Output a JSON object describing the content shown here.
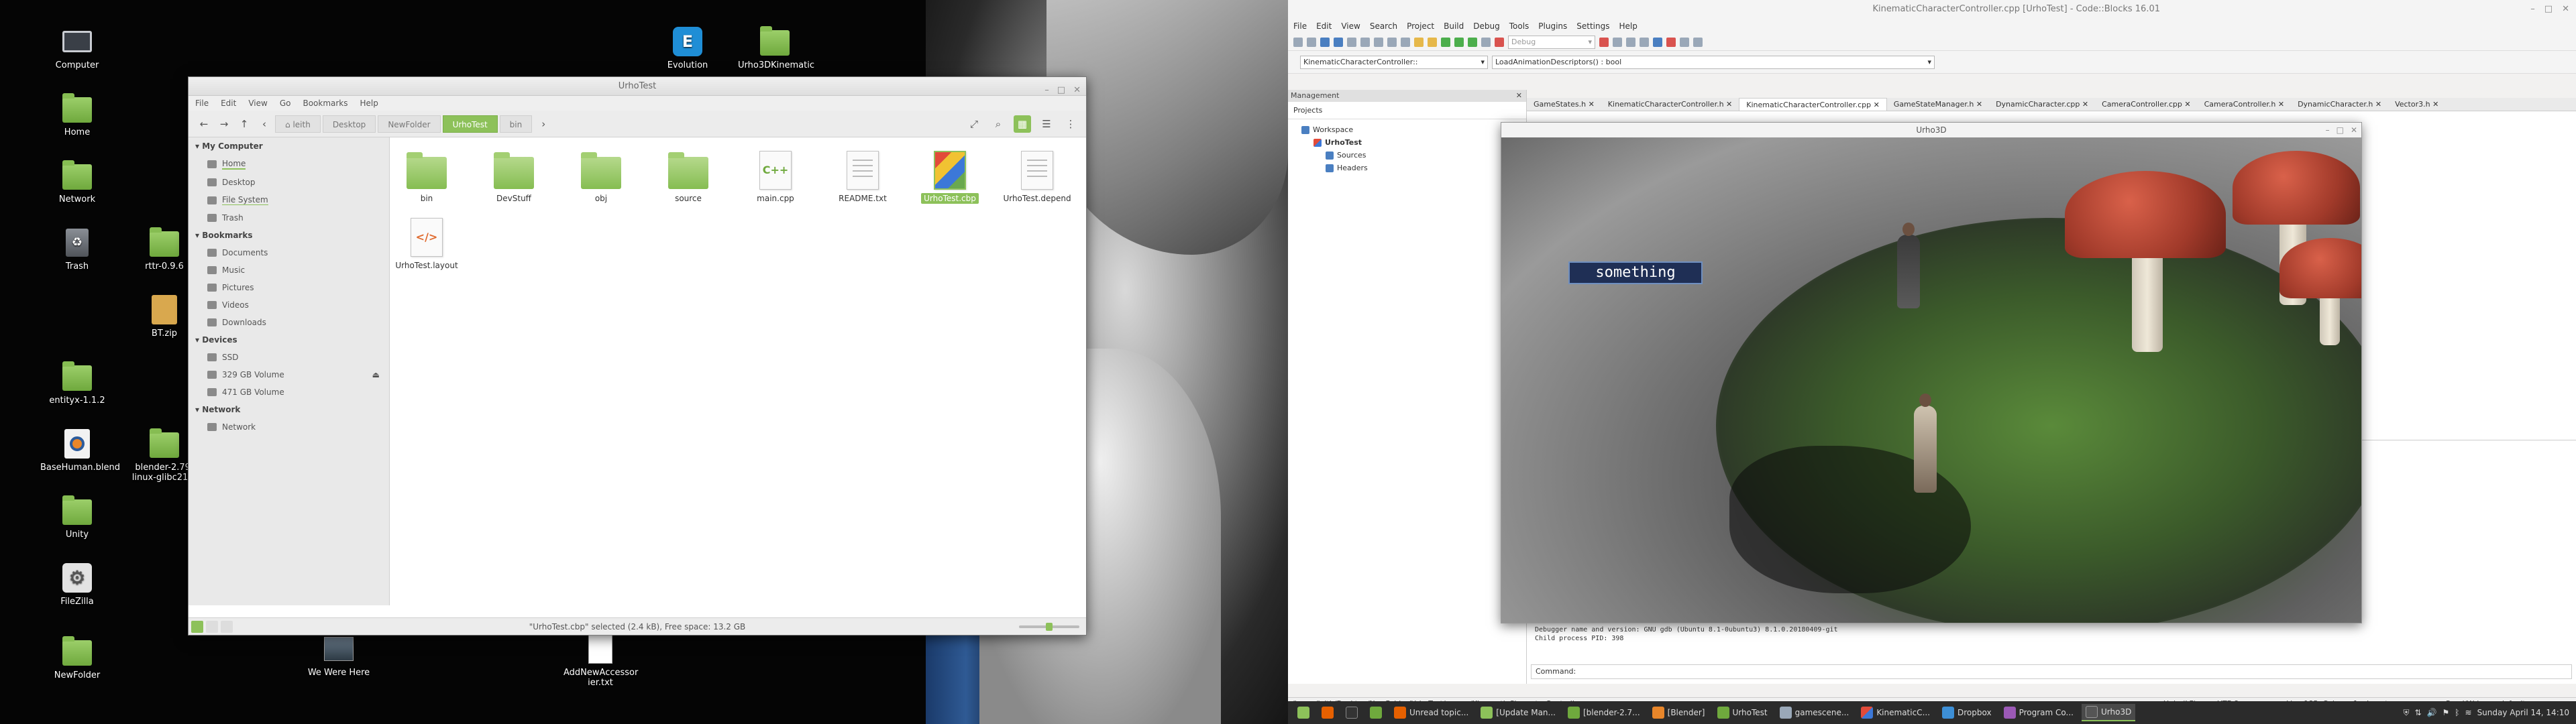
{
  "desktop": {
    "icons_left": [
      {
        "label": "Computer",
        "icon": "computer-icon"
      },
      {
        "label": "Home",
        "icon": "folder-icon"
      },
      {
        "label": "Network",
        "icon": "network-icon"
      },
      {
        "label": "Trash",
        "icon": "trash-icon"
      },
      {
        "label": "rttr-0.9.6",
        "icon": "folder-icon"
      },
      {
        "label": "BT.zip",
        "icon": "zip-icon"
      },
      {
        "label": "entityx-1.1.2",
        "icon": "folder-icon"
      },
      {
        "label": "BaseHuman.blend",
        "icon": "blend-icon"
      },
      {
        "label": "blender-2.79-linux-glibc219-",
        "icon": "folder-icon"
      },
      {
        "label": "Unity",
        "icon": "folder-icon"
      },
      {
        "label": "FileZilla",
        "icon": "gear-icon"
      },
      {
        "label": "NewFolder",
        "icon": "folder-icon"
      }
    ],
    "icons_top": [
      {
        "label": "Evolution",
        "icon": "app-icon"
      },
      {
        "label": "Urho3DKinematic",
        "icon": "folder-icon"
      }
    ],
    "icons_bottom": [
      {
        "label": "We Were Here",
        "icon": "image-icon"
      },
      {
        "label": "AddNewAccessor ier.txt",
        "icon": "text-file-icon"
      }
    ]
  },
  "file_manager": {
    "title": "UrhoTest",
    "menu": [
      "File",
      "Edit",
      "View",
      "Go",
      "Bookmarks",
      "Help"
    ],
    "breadcrumbs": [
      "leith",
      "Desktop",
      "NewFolder",
      "UrhoTest",
      "bin"
    ],
    "active_crumb": "UrhoTest",
    "sidebar": {
      "sections": [
        {
          "title": "My Computer",
          "items": [
            "Home",
            "Desktop",
            "File System",
            "Trash"
          ]
        },
        {
          "title": "Bookmarks",
          "items": [
            "Documents",
            "Music",
            "Pictures",
            "Videos",
            "Downloads"
          ]
        },
        {
          "title": "Devices",
          "items": [
            "SSD",
            "329 GB Volume",
            "471 GB Volume"
          ]
        },
        {
          "title": "Network",
          "items": [
            "Network"
          ]
        }
      ],
      "selected": "Home"
    },
    "files": [
      {
        "name": "bin",
        "type": "folder"
      },
      {
        "name": "DevStuff",
        "type": "folder"
      },
      {
        "name": "obj",
        "type": "folder"
      },
      {
        "name": "source",
        "type": "folder"
      },
      {
        "name": "main.cpp",
        "type": "cpp"
      },
      {
        "name": "README.txt",
        "type": "text"
      },
      {
        "name": "UrhoTest.cbp",
        "type": "cbp",
        "selected": true
      },
      {
        "name": "UrhoTest.depend",
        "type": "text"
      },
      {
        "name": "UrhoTest.layout",
        "type": "layout"
      }
    ],
    "status": "\"UrhoTest.cbp\" selected (2.4 kB), Free space: 13.2 GB"
  },
  "codeblocks": {
    "title": "KinematicCharacterController.cpp [UrhoTest] - Code::Blocks 16.01",
    "menu": [
      "File",
      "Edit",
      "View",
      "Search",
      "Project",
      "Build",
      "Debug",
      "Tools",
      "Plugins",
      "Settings",
      "Help"
    ],
    "build_target": "Debug",
    "scope_select": "KinematicCharacterController::",
    "function_select": "LoadAnimationDescriptors() : bool",
    "management": {
      "title": "Management",
      "tab": "Projects",
      "tree": [
        "Workspace",
        "UrhoTest",
        "Sources",
        "Headers"
      ]
    },
    "tabs": [
      "GameStates.h",
      "KinematicCharacterController.h",
      "KinematicCharacterController.cpp",
      "GameStateManager.h",
      "DynamicCharacter.cpp",
      "CameraController.cpp",
      "CameraController.h",
      "DynamicCharacter.h",
      "Vector3.h"
    ],
    "active_tab": "KinematicCharacterController.cpp",
    "log_lines": [
      "Debugger name and version: GNU gdb (Ubuntu 8.1-0ubuntu3) 8.1.0.20180409-git",
      "Child process PID: 398"
    ],
    "command_label": "Command:",
    "status": {
      "path": "/home/leith/Desktop/NewFolder/UrhoTest/source/KinematicCharacterController.cpp",
      "eol": "Unix (LF)",
      "encoding": "UTF-8",
      "position": "Line 185, Column 1",
      "mode": "Insert",
      "rw": "Read/Wri...",
      "default": "default"
    }
  },
  "urho": {
    "title": "Urho3D",
    "ui_text": "something"
  },
  "taskbar": {
    "items": [
      "Unread topic...",
      "[Update Man...",
      "[blender-2.7...",
      "[Blender]",
      "UrhoTest",
      "gamescene...",
      "KinematicC...",
      "Dropbox",
      "Program Co...",
      "Urho3D"
    ],
    "active": "Urho3D",
    "clock": "Sunday April 14, 14:10"
  }
}
